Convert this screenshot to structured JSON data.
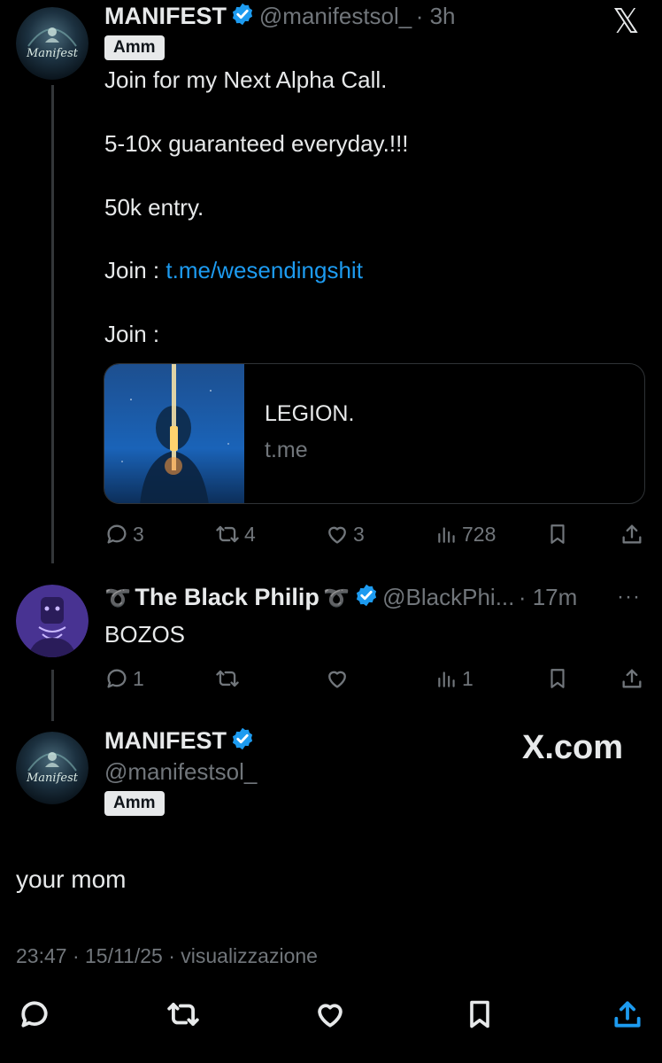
{
  "post1": {
    "author_name": "MANIFEST",
    "handle": "@manifestsol_",
    "time": "· 3h",
    "tag": "Amm",
    "avatar_label": "Manifest",
    "lines": {
      "l1": "Join for my Next Alpha Call.",
      "l2": "5-10x guaranteed everyday.!!!",
      "l3": "50k entry.",
      "l4_prefix": "Join : ",
      "l4_link": "t.me/wesendingshit",
      "l5": "Join :"
    },
    "card": {
      "title": "LEGION.",
      "domain": "t.me"
    },
    "actions": {
      "replies": "3",
      "reposts": "4",
      "likes": "3",
      "views": "728"
    }
  },
  "header_logo": "𝕏",
  "reply": {
    "author_name": "The Black Philip",
    "decor": "➰",
    "handle": "@BlackPhi...",
    "time": "· 17m",
    "more": "···",
    "text": "BOZOS",
    "actions": {
      "replies": "1",
      "reposts": "",
      "likes": "",
      "views": "1"
    }
  },
  "post2": {
    "author_name": "MANIFEST",
    "handle": "@manifestsol_",
    "tag": "Amm",
    "avatar_label": "Manifest",
    "watermark": "X.com",
    "text": "your mom",
    "meta": "23:47 · 15/11/25 · visualizzazione"
  },
  "colors": {
    "accent": "#1d9bf0",
    "background": "#000000",
    "text": "#e7e9ea",
    "muted": "#71767b"
  },
  "icons": [
    "reply-icon",
    "repost-icon",
    "like-icon",
    "views-icon",
    "bookmark-icon",
    "share-icon",
    "verified-icon",
    "more-icon",
    "x-logo-icon"
  ]
}
